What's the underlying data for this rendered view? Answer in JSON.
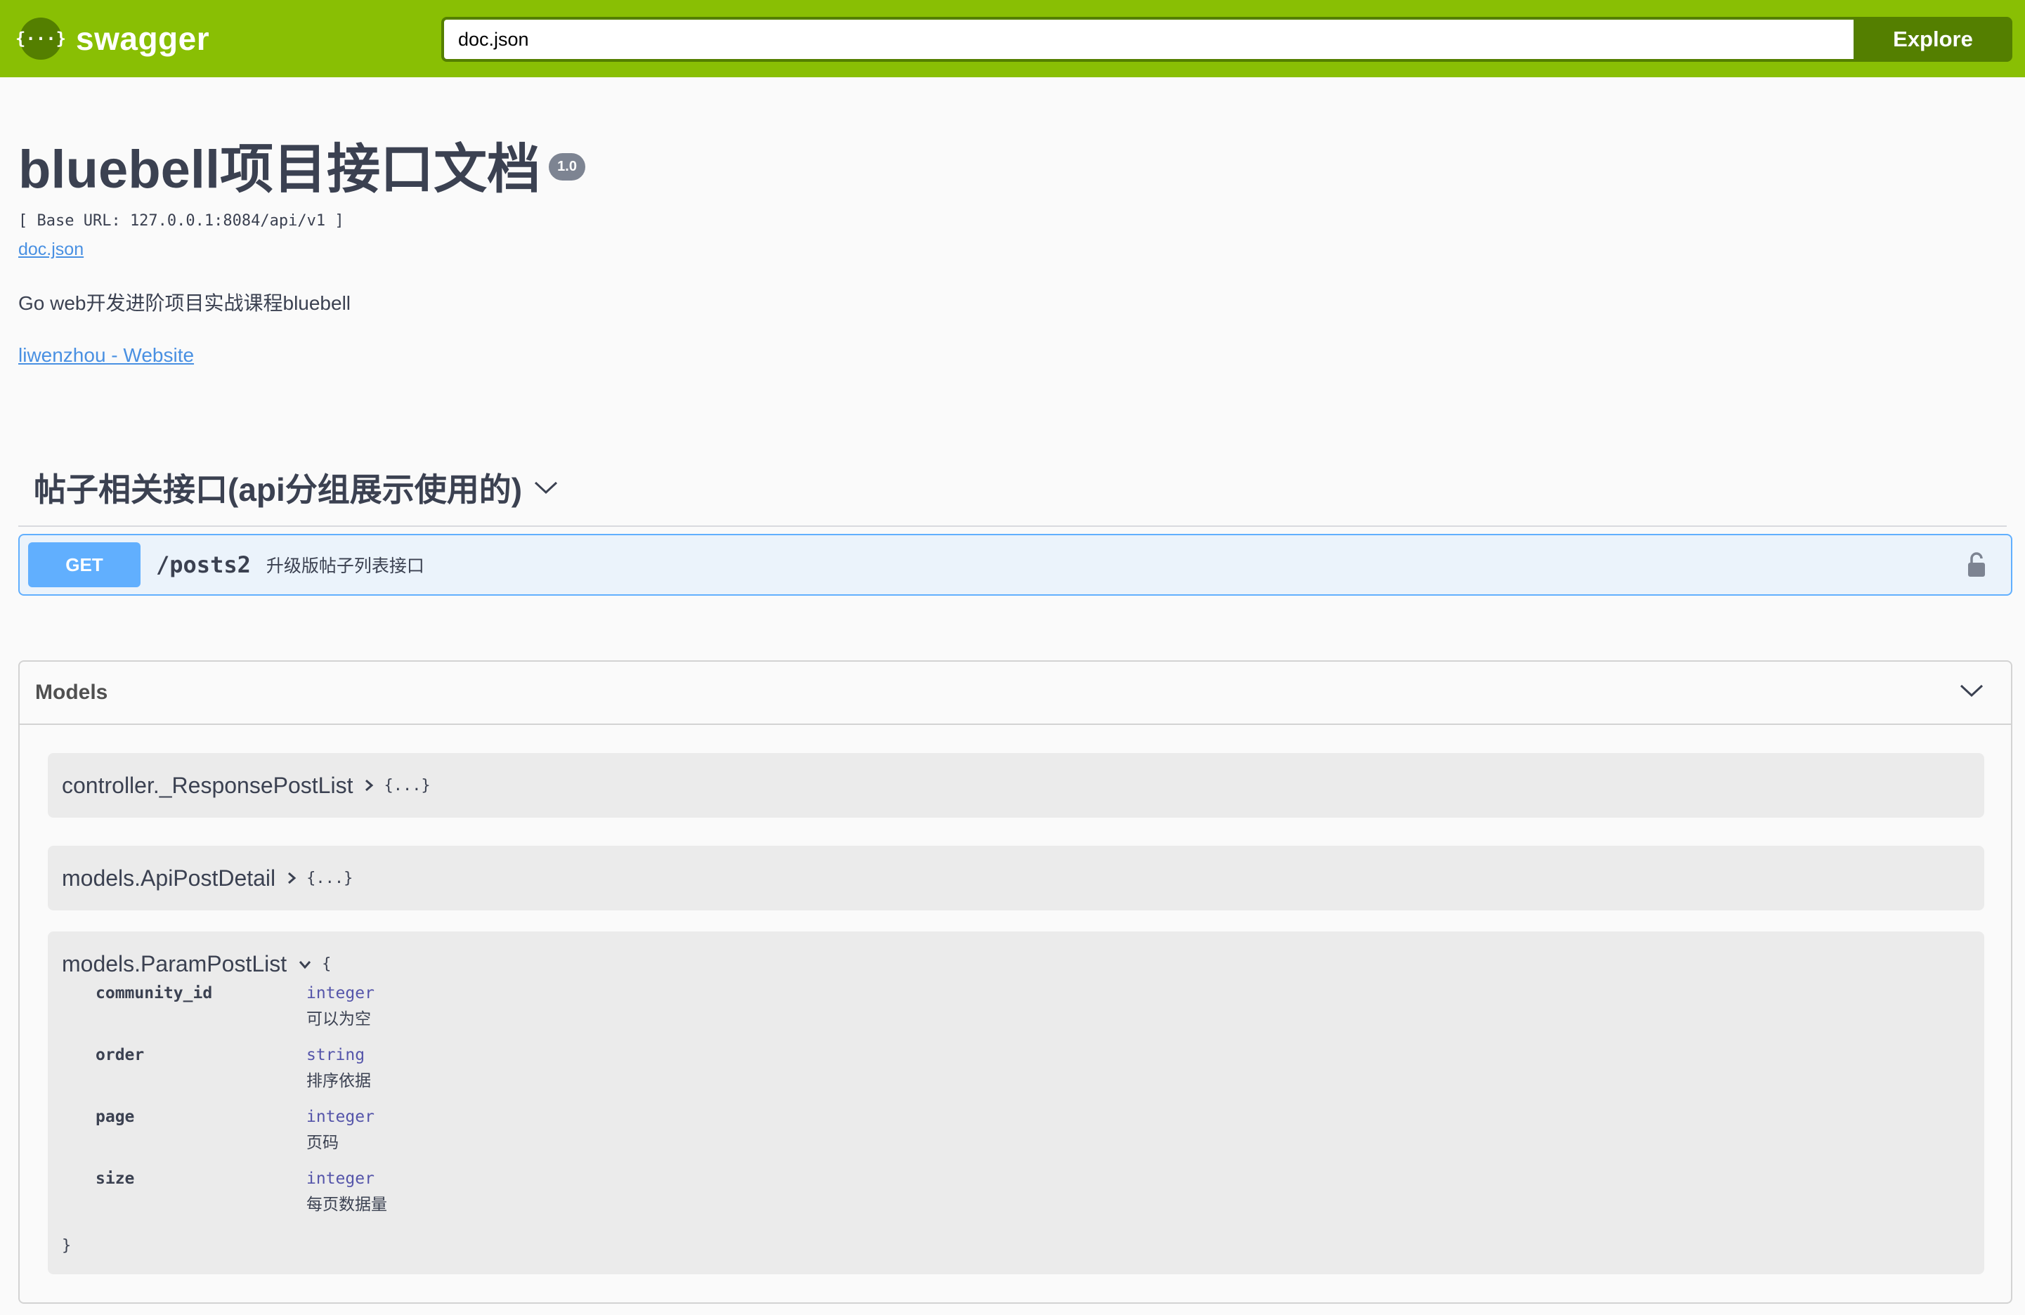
{
  "topbar": {
    "logo_glyph": "{···}",
    "brand": "swagger",
    "url_value": "doc.json",
    "explore_label": "Explore",
    "colors": {
      "bar": "#89bf04",
      "dark": "#547f00"
    }
  },
  "info": {
    "title": "bluebell项目接口文档",
    "version": "1.0",
    "base_url": "[ Base URL: 127.0.0.1:8084/api/v1 ]",
    "spec_link": "doc.json",
    "description": "Go web开发进阶项目实战课程bluebell",
    "contact_link": "liwenzhou - Website"
  },
  "tag": {
    "title": "帖子相关接口(api分组展示使用的)",
    "operation": {
      "method": "GET",
      "path": "/posts2",
      "summary": "升级版帖子列表接口",
      "lock_icon": "lock-icon",
      "color": "#61affe"
    }
  },
  "models": {
    "title": "Models",
    "items": [
      {
        "name": "controller._ResponsePostList",
        "collapsed_text": "{...}"
      },
      {
        "name": "models.ApiPostDetail",
        "collapsed_text": "{...}"
      }
    ],
    "expanded": {
      "name": "models.ParamPostList",
      "open_brace": "{",
      "close_brace": "}",
      "properties": [
        {
          "name": "community_id",
          "type": "integer",
          "desc": "可以为空"
        },
        {
          "name": "order",
          "type": "string",
          "desc": "排序依据"
        },
        {
          "name": "page",
          "type": "integer",
          "desc": "页码"
        },
        {
          "name": "size",
          "type": "integer",
          "desc": "每页数据量"
        }
      ]
    }
  }
}
